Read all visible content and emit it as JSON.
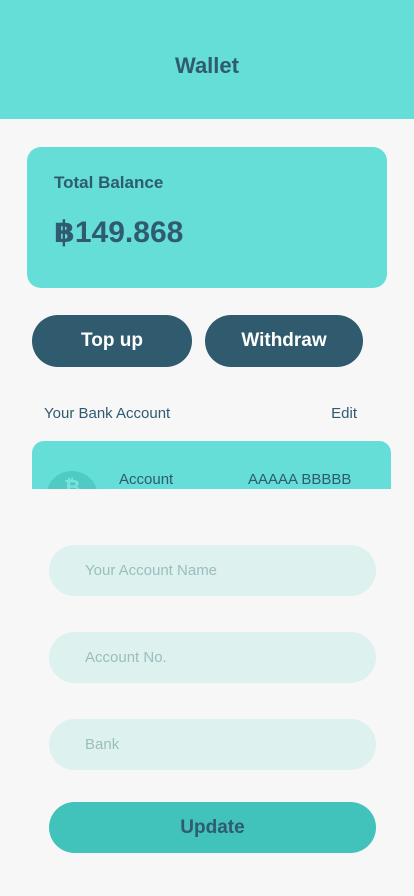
{
  "header": {
    "title": "Wallet"
  },
  "balance": {
    "label": "Total Balance",
    "amount": "฿149.868"
  },
  "actions": {
    "topup_label": "Top up",
    "withdraw_label": "Withdraw"
  },
  "bank_section": {
    "title": "Your Bank Account",
    "edit_label": "Edit"
  },
  "bank_card": {
    "account_label": "Account",
    "account_value": "AAAAA BBBBB"
  },
  "form": {
    "account_name_placeholder": "Your Account Name",
    "account_no_placeholder": "Account No.",
    "bank_placeholder": "Bank",
    "update_label": "Update"
  },
  "colors": {
    "accent": "#64ded6",
    "dark": "#305a6e",
    "text": "#2f5a70",
    "input_bg": "#ddf1ef",
    "update_bg": "#41c2bb"
  }
}
